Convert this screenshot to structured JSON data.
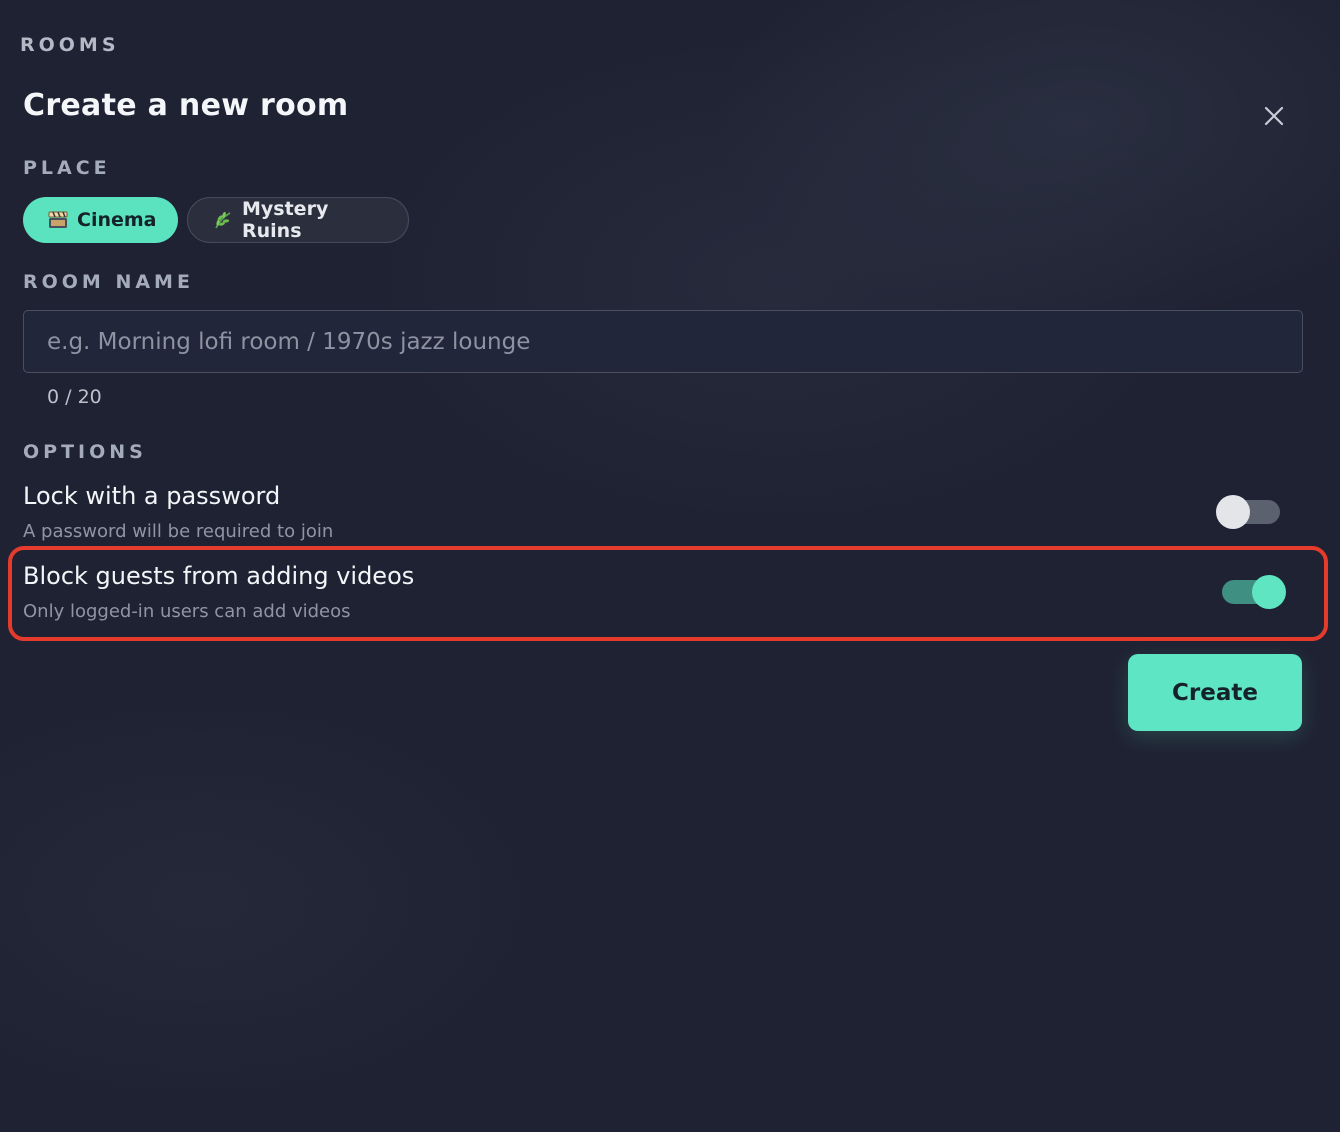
{
  "header": {
    "section": "ROOMS",
    "title": "Create a new room"
  },
  "place": {
    "label": "PLACE",
    "options": [
      {
        "label": "Cinema",
        "icon": "cinema-icon",
        "selected": true
      },
      {
        "label": "Mystery Ruins",
        "icon": "leaf-icon",
        "selected": false
      }
    ]
  },
  "room_name": {
    "label": "ROOM NAME",
    "placeholder": "e.g. Morning lofi room / 1970s jazz lounge",
    "value": "",
    "count": "0 / 20"
  },
  "options": {
    "label": "OPTIONS",
    "items": [
      {
        "title": "Lock with a password",
        "description": "A password will be required to join",
        "enabled": false
      },
      {
        "title": "Block guests from adding videos",
        "description": "Only logged-in users can add videos",
        "enabled": true
      }
    ]
  },
  "actions": {
    "create_label": "Create"
  },
  "colors": {
    "background": "#1f2232",
    "accent": "#5ee5c3",
    "highlight": "#e53b2c"
  }
}
